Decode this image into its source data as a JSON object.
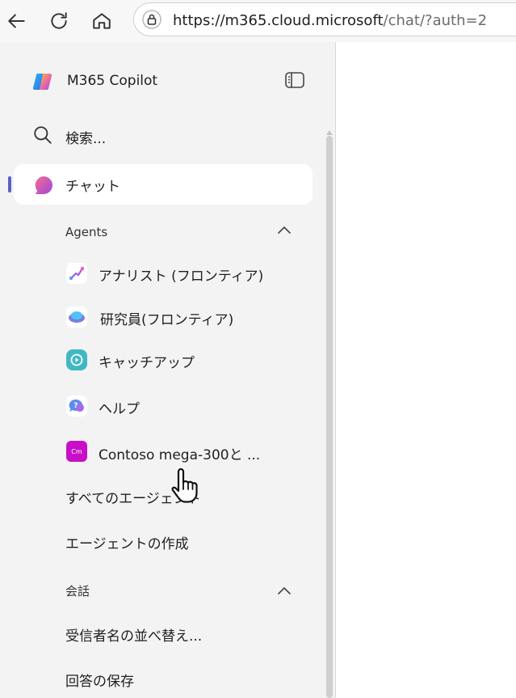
{
  "browser": {
    "url_host": "https://m365.cloud.microsoft",
    "url_path": "/chat/?auth=2",
    "icons": [
      "back-arrow-icon",
      "refresh-icon",
      "home-icon",
      "lock-icon"
    ]
  },
  "sidebar": {
    "brand": "M365 Copilot",
    "search_label": "検索...",
    "chat_label": "チャット",
    "agents_header": "Agents",
    "agents": [
      {
        "label": "アナリスト (フロンティア)",
        "icon": "analyst-icon"
      },
      {
        "label": "研究員(フロンティア)",
        "icon": "researcher-icon"
      },
      {
        "label": "キャッチアップ",
        "icon": "catchup-icon"
      },
      {
        "label": "ヘルプ",
        "icon": "help-icon"
      },
      {
        "label": "Contoso mega-300と ...",
        "icon": "contoso-icon",
        "icon_text": "Cm"
      }
    ],
    "all_agents": "すべてのエージェント",
    "create_agent": "エージェントの作成",
    "conversations_header": "会話",
    "conversations": [
      "受信者名の並べ替え...",
      "回答の保存"
    ]
  },
  "colors": {
    "accent": "#5b5fc7",
    "contoso": "#c70fc7",
    "catchup": "#3fb8c4"
  }
}
